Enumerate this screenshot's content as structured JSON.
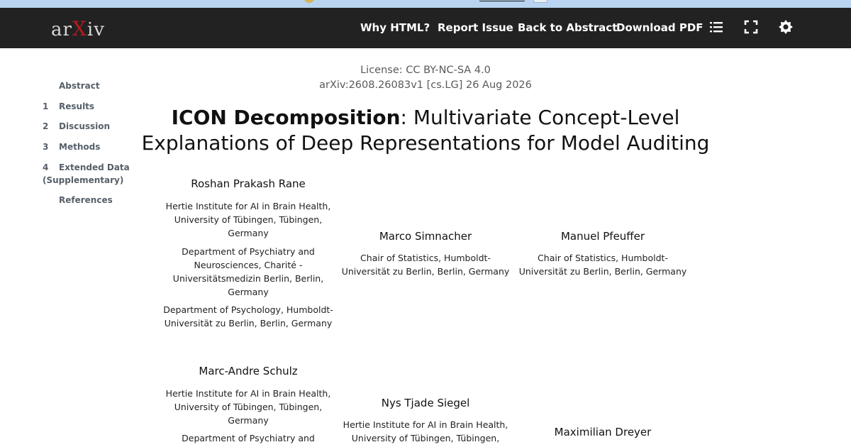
{
  "nav": {
    "logo": {
      "pre": "ar",
      "x": "X",
      "post": "iv"
    },
    "links": [
      "Why HTML?",
      "Report Issue",
      "Back to Abstract",
      "Download PDF"
    ],
    "icons": [
      "list-icon",
      "fullscreen-icon",
      "settings-icon"
    ]
  },
  "toc": {
    "abstract": "Abstract",
    "items": [
      {
        "num": "1",
        "label": "Results"
      },
      {
        "num": "2",
        "label": "Discussion"
      },
      {
        "num": "3",
        "label": "Methods"
      },
      {
        "num": "4",
        "label": "Extended Data",
        "sub": "(Supplementary)"
      }
    ],
    "references": "References"
  },
  "paper": {
    "license": "License: CC BY-NC-SA 4.0",
    "arxiv_id": "arXiv:2608.26083v1 [cs.LG] 26 Aug 2026",
    "title_bold": "ICON Decomposition",
    "title_line1_rest": ": Multivariate Concept-Level",
    "title_line2": "Explanations of Deep Representations for Model Auditing"
  },
  "authors": [
    {
      "name": "Roshan Prakash Rane",
      "affiliations": [
        [
          "Hertie Institute for AI in Brain Health,",
          "University of Tübingen, Tübingen,",
          "Germany"
        ],
        [
          "Department of Psychiatry and",
          "Neurosciences, Charité -",
          "Universitätsmedizin Berlin, Berlin,",
          "Germany"
        ],
        [
          "Department of Psychology, Humboldt-",
          "Universität zu Berlin, Berlin, Germany"
        ]
      ]
    },
    {
      "name": "Marco Simnacher",
      "affiliations": [
        [
          "Chair of Statistics, Humboldt-",
          "Universität zu Berlin, Berlin, Germany"
        ]
      ]
    },
    {
      "name": "Manuel Pfeuffer",
      "affiliations": [
        [
          "Chair of Statistics, Humboldt-",
          "Universität zu Berlin, Berlin, Germany"
        ]
      ]
    },
    {
      "name": "Marc-Andre Schulz",
      "affiliations": [
        [
          "Hertie Institute for AI in Brain Health,",
          "University of Tübingen, Tübingen,",
          "Germany"
        ],
        [
          "Department of Psychiatry and"
        ]
      ]
    },
    {
      "name": "Nys Tjade Siegel",
      "affiliations": [
        [
          "Hertie Institute for AI in Brain Health,",
          "University of Tübingen, Tübingen,"
        ]
      ]
    },
    {
      "name": "Maximilian Dreyer",
      "affiliations": []
    }
  ]
}
